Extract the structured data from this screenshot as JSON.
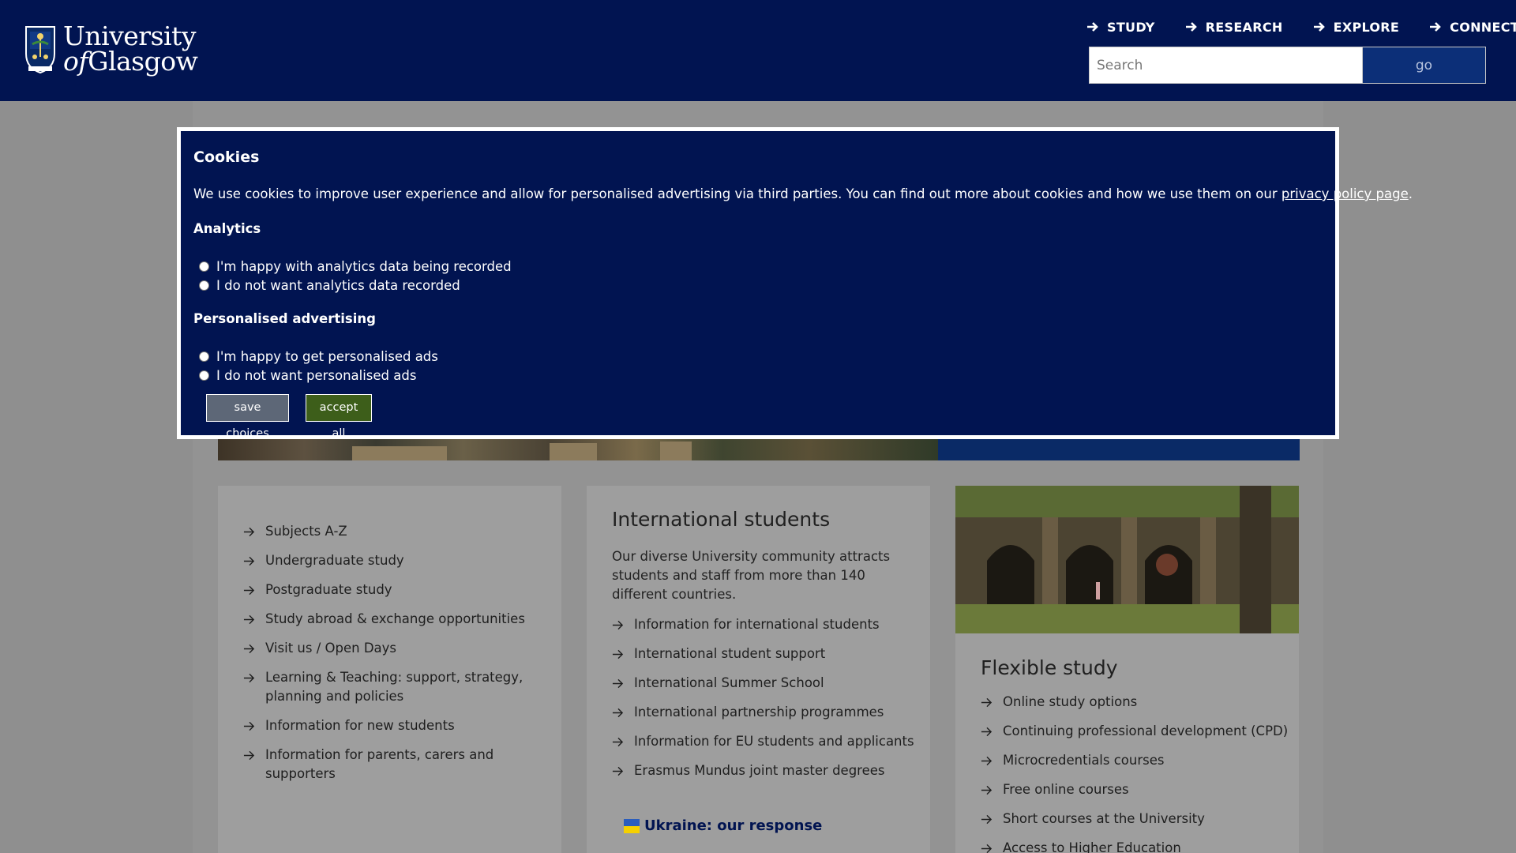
{
  "header": {
    "logo": {
      "line1": "University",
      "line2_italic": "of",
      "line2": "Glasgow"
    },
    "nav": [
      {
        "label": "STUDY"
      },
      {
        "label": "RESEARCH"
      },
      {
        "label": "EXPLORE"
      },
      {
        "label": "CONNECT"
      }
    ],
    "search": {
      "placeholder": "Search",
      "button_label": "go"
    }
  },
  "cookie_banner": {
    "title": "Cookies",
    "text": "We use cookies to improve user experience and allow for personalised advertising via third parties. You can find out more about cookies and how we use them on our ",
    "link_text": "privacy policy page",
    "text_end": ".",
    "analytics": {
      "title": "Analytics",
      "options": [
        "I'm happy with analytics data being recorded",
        "I do not want analytics data recorded"
      ]
    },
    "advertising": {
      "title": "Personalised advertising",
      "options": [
        "I'm happy to get personalised ads",
        "I do not want personalised ads"
      ]
    },
    "buttons": {
      "save": "save choices",
      "accept": "accept all"
    }
  },
  "study_links": [
    "Subjects A-Z",
    "Undergraduate study",
    "Postgraduate study",
    "Study abroad & exchange opportunities",
    "Visit us / Open Days",
    "Learning & Teaching: support, strategy, planning and policies",
    "Information for new students",
    "Information for parents, carers and supporters"
  ],
  "international": {
    "title": "International students",
    "description": "Our diverse University community attracts students and staff from more than 140 different countries.",
    "links": [
      "Information for international students",
      "International student support",
      "International Summer School",
      "International partnership programmes",
      "Information for EU students and applicants",
      "Erasmus Mundus joint master degrees"
    ],
    "ukraine_label": "Ukraine: our response"
  },
  "flexible": {
    "title": "Flexible study",
    "links": [
      "Online study options",
      "Continuing professional development (CPD)",
      "Microcredentials courses",
      "Free online courses",
      "Short courses at the University",
      "Access to Higher Education"
    ]
  },
  "colors": {
    "navy": "#011451",
    "overlay_gray": "#8f8f8f",
    "save_button": "#5d6777",
    "accept_button": "#3d5e1a"
  }
}
